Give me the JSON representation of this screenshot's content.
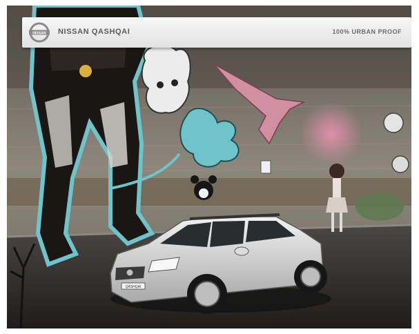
{
  "header": {
    "logo_icon": "nissan-logo-icon",
    "logo_text": "NISSAN",
    "title": "NISSAN QASHQAI",
    "tagline": "100% URBAN PROOF"
  },
  "scene": {
    "description_icon": "graffiti-wall-car-image",
    "car_plate_text": "QASHQAI",
    "colors": {
      "wall": "#8a8378",
      "street": "#3a3a3a",
      "graffiti_cyan": "#6fc4cc",
      "graffiti_pink": "#d9839a",
      "car_silver": "#d8d8d8"
    }
  }
}
